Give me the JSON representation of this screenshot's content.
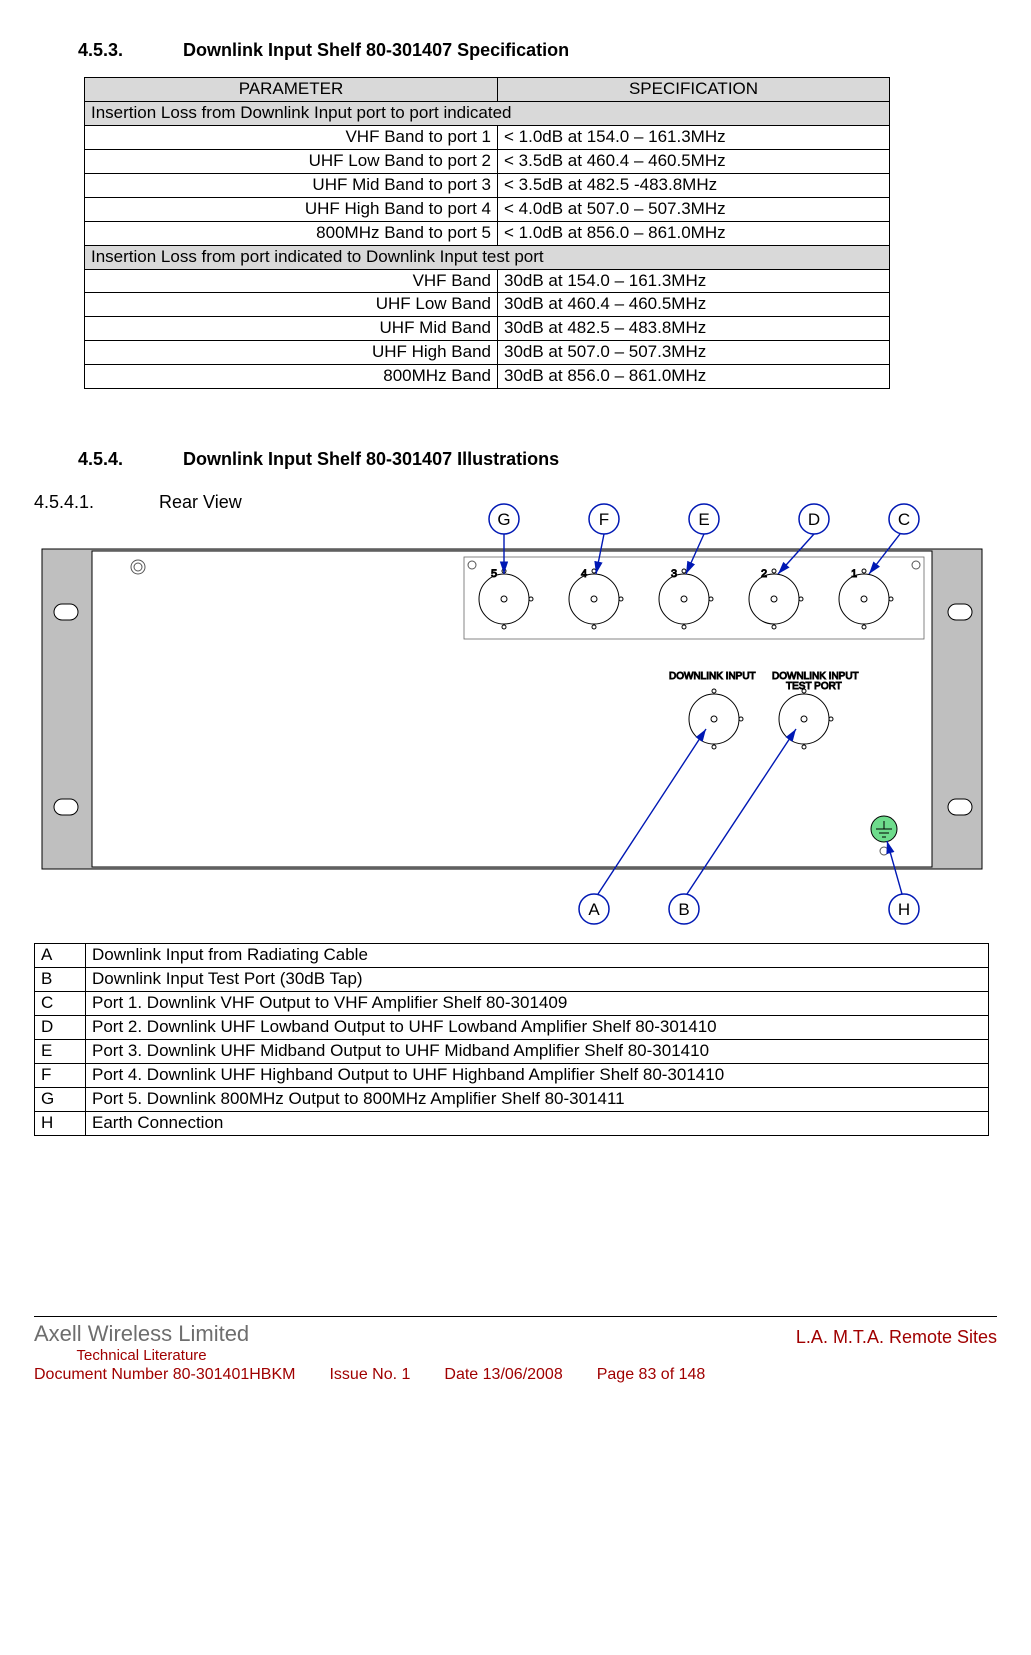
{
  "section453": {
    "num": "4.5.3.",
    "title": "Downlink Input Shelf 80-301407 Specification"
  },
  "specTable": {
    "headers": {
      "p": "PARAMETER",
      "s": "SPECIFICATION"
    },
    "group1": "Insertion Loss from Downlink Input port to port indicated",
    "rows1": [
      {
        "p": "VHF Band to port 1",
        "s": "< 1.0dB at 154.0 – 161.3MHz"
      },
      {
        "p": "UHF Low Band to port 2",
        "s": "< 3.5dB at 460.4 – 460.5MHz"
      },
      {
        "p": "UHF Mid Band to port 3",
        "s": "< 3.5dB at 482.5 -483.8MHz"
      },
      {
        "p": "UHF High Band to port 4",
        "s": "< 4.0dB at 507.0 – 507.3MHz"
      },
      {
        "p": "800MHz Band to port 5",
        "s": "< 1.0dB at 856.0 – 861.0MHz"
      }
    ],
    "group2": "Insertion Loss from port indicated to Downlink Input test port",
    "rows2": [
      {
        "p": "VHF Band",
        "s": "30dB at 154.0 – 161.3MHz"
      },
      {
        "p": "UHF Low Band",
        "s": "30dB at 460.4 – 460.5MHz"
      },
      {
        "p": "UHF Mid Band",
        "s": "30dB at 482.5 – 483.8MHz"
      },
      {
        "p": "UHF High Band",
        "s": "30dB at 507.0 – 507.3MHz"
      },
      {
        "p": "800MHz Band",
        "s": "30dB at 856.0 – 861.0MHz"
      }
    ]
  },
  "section454": {
    "num": "4.5.4.",
    "title": "Downlink Input Shelf 80-301407 Illustrations"
  },
  "sub4541": {
    "num": "4.5.4.1.",
    "title": "Rear View"
  },
  "labels": {
    "G": "G",
    "F": "F",
    "E": "E",
    "D": "D",
    "C": "C",
    "A": "A",
    "B": "B",
    "H": "H",
    "p1": "1",
    "p2": "2",
    "p3": "3",
    "p4": "4",
    "p5": "5",
    "dl": "DOWNLINK INPUT",
    "dltp": "DOWNLINK INPUT",
    "dltp2": "TEST PORT"
  },
  "callouts": [
    {
      "k": "A",
      "v": "Downlink Input from Radiating Cable"
    },
    {
      "k": "B",
      "v": "Downlink Input Test Port (30dB Tap)"
    },
    {
      "k": "C",
      "v": "Port 1. Downlink VHF Output to VHF Amplifier Shelf 80-301409"
    },
    {
      "k": "D",
      "v": "Port 2. Downlink UHF Lowband Output to UHF Lowband Amplifier Shelf 80-301410"
    },
    {
      "k": "E",
      "v": "Port 3. Downlink UHF Midband Output to UHF Midband Amplifier Shelf 80-301410"
    },
    {
      "k": "F",
      "v": "Port 4. Downlink UHF Highband Output to UHF Highband Amplifier Shelf 80-301410"
    },
    {
      "k": "G",
      "v": "Port 5. Downlink 800MHz Output to 800MHz Amplifier Shelf 80-301411"
    },
    {
      "k": "H",
      "v": "Earth Connection"
    }
  ],
  "footer": {
    "company": "Axell Wireless Limited",
    "techlit": "Technical Literature",
    "site": "L.A. M.T.A. Remote Sites",
    "doc": "Document Number 80-301401HBKM",
    "issue": "Issue No. 1",
    "date": "Date 13/06/2008",
    "page": "Page 83 of 148"
  }
}
